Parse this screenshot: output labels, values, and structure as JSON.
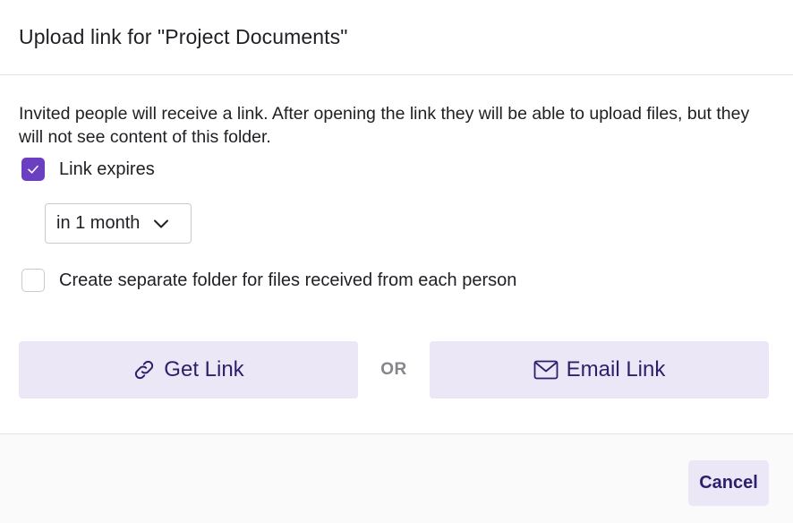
{
  "dialog": {
    "title": "Upload link for \"Project Documents\"",
    "description": "Invited people will receive a link. After opening the link they will be able to upload files, but they will not see content of this folder."
  },
  "options": {
    "link_expires": {
      "label": "Link expires",
      "checked": true
    },
    "expiry_select": {
      "value": "in 1 month"
    },
    "separate_folder": {
      "label": "Create separate folder for files received from each person",
      "checked": false
    }
  },
  "actions": {
    "get_link": {
      "label": "Get Link",
      "icon": "link-icon"
    },
    "or_label": "OR",
    "email_link": {
      "label": "Email Link",
      "icon": "envelope-icon"
    }
  },
  "footer": {
    "cancel_label": "Cancel"
  },
  "colors": {
    "accent": "#6a3fc0",
    "button_bg": "#ebe7f7",
    "button_text": "#2e1f6b",
    "muted_text": "#85858c"
  }
}
